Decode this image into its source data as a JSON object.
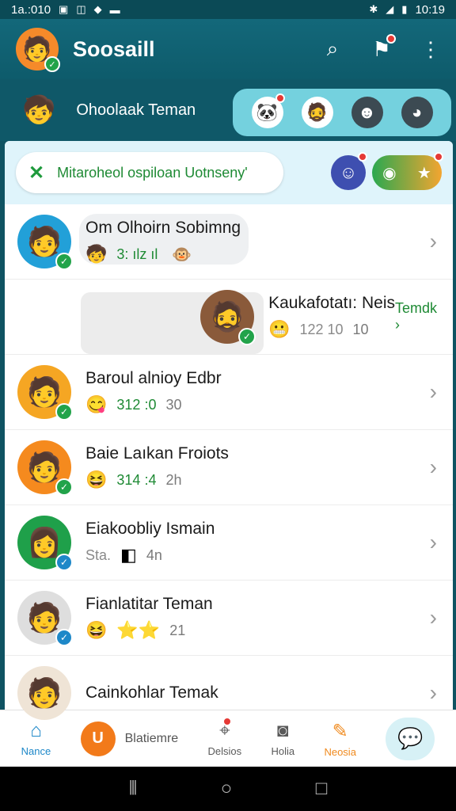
{
  "status_bar": {
    "time_left": "1a.:010",
    "time_right": "10:19",
    "icons_left": [
      "image-icon",
      "notification-icon",
      "signal-icon",
      "minus-icon"
    ],
    "icons_right": [
      "bluetooth-icon",
      "signal-bars-icon",
      "battery-icon"
    ]
  },
  "app_bar": {
    "title": "Soosaill",
    "icons": [
      "search-icon",
      "chat-flag-icon",
      "more-vertical-icon"
    ]
  },
  "friend_bar": {
    "title": "Ohoolaak Teman"
  },
  "notice": {
    "text": "Mitaroheol ospiloan Uotnseny'"
  },
  "contacts": [
    {
      "name": "Om Olhoirn Sobimng",
      "value": "3: ılz ıl"
    },
    {
      "name": "Kaukafotatı: Neis",
      "value": "122 10",
      "time": "10",
      "action": "Temdk ›"
    },
    {
      "name": "Baroul alnioy Edbr",
      "value": "312 :0",
      "time": "30"
    },
    {
      "name": "Baie Laıkan Froiots",
      "value": "314 :4",
      "time": "2h"
    },
    {
      "name": "Eiakoobliy Ismain",
      "value": "Sta.",
      "time": "4n"
    },
    {
      "name": "Fianlatitar Teman",
      "time": "21"
    },
    {
      "name": "Cainkohlar Temak"
    }
  ],
  "bottom_nav": {
    "home": "Nance",
    "center": "Blatiemre",
    "center_glyph": "U",
    "places": "Delsios",
    "help": "Holia",
    "news": "Neosia"
  },
  "colors": {
    "primary": "#13687a",
    "accent_green": "#1e8a34",
    "accent_blue": "#1e88c8",
    "accent_orange": "#f27a1a"
  }
}
